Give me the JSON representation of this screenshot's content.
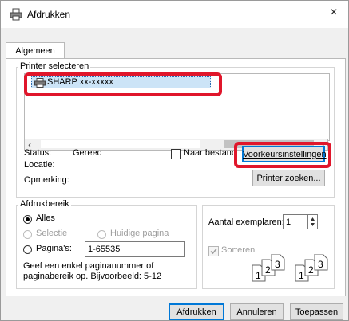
{
  "window": {
    "title": "Afdrukken",
    "close_glyph": "×"
  },
  "tabs": [
    {
      "label": "Algemeen"
    }
  ],
  "printer_group": {
    "label": "Printer selecteren",
    "printers": [
      {
        "name": "SHARP xx-xxxxx",
        "selected": true
      }
    ],
    "scroll_left": "‹",
    "scroll_right": "›"
  },
  "status": {
    "status_label": "Status:",
    "status_value": "Gereed",
    "location_label": "Locatie:",
    "location_value": "",
    "comment_label": "Opmerking:",
    "comment_value": "",
    "print_to_file_label": "Naar bestand",
    "preferences_button": "Voorkeursinstellingen",
    "find_printer_button": "Printer zoeken..."
  },
  "range_group": {
    "label": "Afdrukbereik",
    "all_label": "Alles",
    "selection_label": "Selectie",
    "current_page_label": "Huidige pagina",
    "pages_label": "Pagina's:",
    "pages_value": "1-65535",
    "hint": "Geef een enkel paginanummer of paginabereik op. Bijvoorbeeld: 5-12"
  },
  "copies": {
    "label": "Aantal exemplaren:",
    "value": "1",
    "collate_label": "Sorteren"
  },
  "footer": {
    "print_button": "Afdrukken",
    "cancel_button": "Annuleren",
    "apply_button": "Toepassen"
  },
  "colors": {
    "highlight_red": "#e0162b",
    "selection_blue": "#cce4f7",
    "focus_blue": "#0078d7"
  },
  "icons": {
    "title_icon": "printer-icon",
    "list_icon": "printer-icon",
    "collate_icon": "collate-pages-icon"
  }
}
